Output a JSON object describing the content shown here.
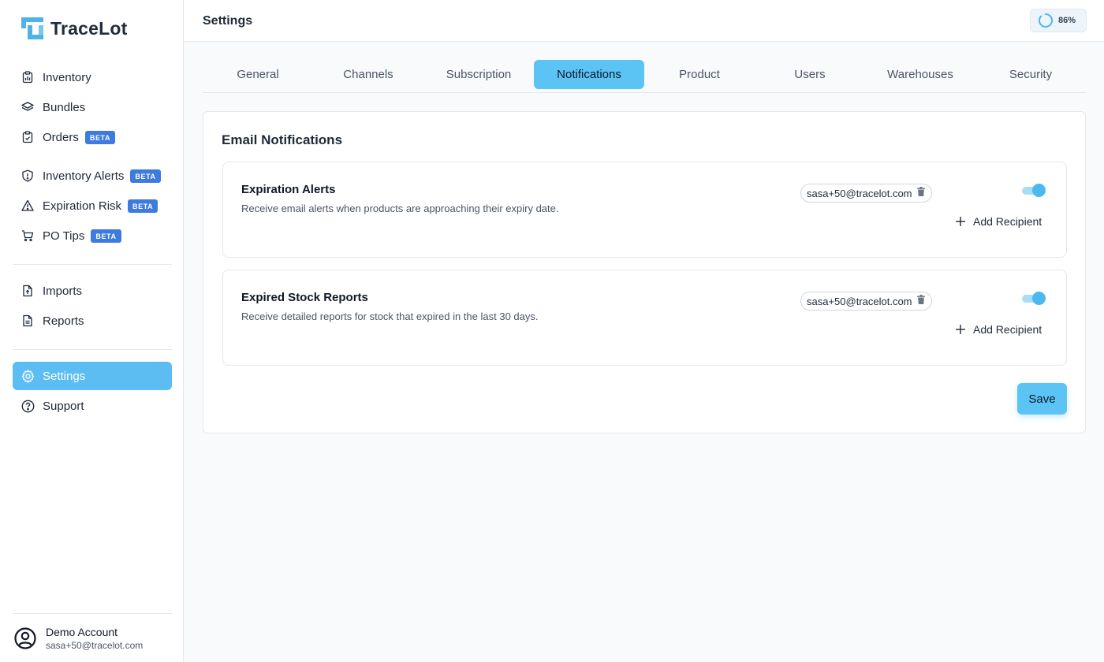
{
  "app": {
    "name": "TraceLot",
    "brand_color": "#5bc4f5"
  },
  "sidebar": {
    "group1": [
      {
        "label": "Inventory",
        "icon": "clipboard-chart-icon",
        "beta": ""
      },
      {
        "label": "Bundles",
        "icon": "layers-icon",
        "beta": ""
      },
      {
        "label": "Orders",
        "icon": "clipboard-check-icon",
        "beta": "BETA"
      }
    ],
    "group2": [
      {
        "label": "Inventory Alerts",
        "icon": "shield-alert-icon",
        "beta": "BETA"
      },
      {
        "label": "Expiration Risk",
        "icon": "warning-triangle-icon",
        "beta": "BETA"
      },
      {
        "label": "PO Tips",
        "icon": "cart-icon",
        "beta": "BETA"
      }
    ],
    "group3": [
      {
        "label": "Imports",
        "icon": "file-upload-icon"
      },
      {
        "label": "Reports",
        "icon": "file-text-icon"
      }
    ],
    "group4": [
      {
        "label": "Settings",
        "icon": "gear-icon",
        "active": true
      },
      {
        "label": "Support",
        "icon": "help-circle-icon"
      }
    ],
    "account": {
      "name": "Demo Account",
      "email": "sasa+50@tracelot.com",
      "icon": "user-circle-icon"
    }
  },
  "header": {
    "title": "Settings",
    "progress_label": "86%",
    "progress_value": 0.86
  },
  "tabs": [
    {
      "label": "General"
    },
    {
      "label": "Channels"
    },
    {
      "label": "Subscription"
    },
    {
      "label": "Notifications",
      "active": true
    },
    {
      "label": "Product"
    },
    {
      "label": "Users"
    },
    {
      "label": "Warehouses"
    },
    {
      "label": "Security"
    }
  ],
  "notifications": {
    "section_title": "Email Notifications",
    "items": [
      {
        "title": "Expiration Alerts",
        "description": "Receive email alerts when products are approaching their expiry date.",
        "recipient": "sasa+50@tracelot.com",
        "enabled": true,
        "add_label": "Add Recipient"
      },
      {
        "title": "Expired Stock Reports",
        "description": "Receive detailed reports for stock that expired in the last 30 days.",
        "recipient": "sasa+50@tracelot.com",
        "enabled": true,
        "add_label": "Add Recipient"
      }
    ],
    "save_label": "Save"
  }
}
